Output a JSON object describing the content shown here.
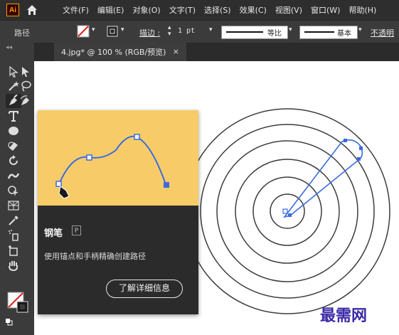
{
  "app": {
    "logo_text": "Ai"
  },
  "menu": {
    "items": [
      "文件(F)",
      "编辑(E)",
      "对象(O)",
      "文字(T)",
      "选择(S)",
      "效果(C)",
      "视图(V)",
      "窗口(W)",
      "帮助(H)"
    ]
  },
  "control_bar": {
    "selection_label": "路径",
    "stroke_label": "描边 :",
    "stroke_value": "1 pt",
    "profile_label": "等比",
    "brush_label": "基本",
    "opacity_label": "不透明"
  },
  "document_tab": {
    "title": "4.jpg* @ 100 % (RGB/预览)",
    "close": "×"
  },
  "tooltip": {
    "title": "钢笔",
    "shortcut": "P",
    "description": "使用锚点和手柄精确创建路径",
    "button_label": "了解详细信息",
    "art_bg": "#f7cc68"
  },
  "colors": {
    "accent": "#3b6ae0",
    "menubar": "#2e2e2e",
    "panel": "#3b3b3b"
  },
  "watermark": "最需网"
}
